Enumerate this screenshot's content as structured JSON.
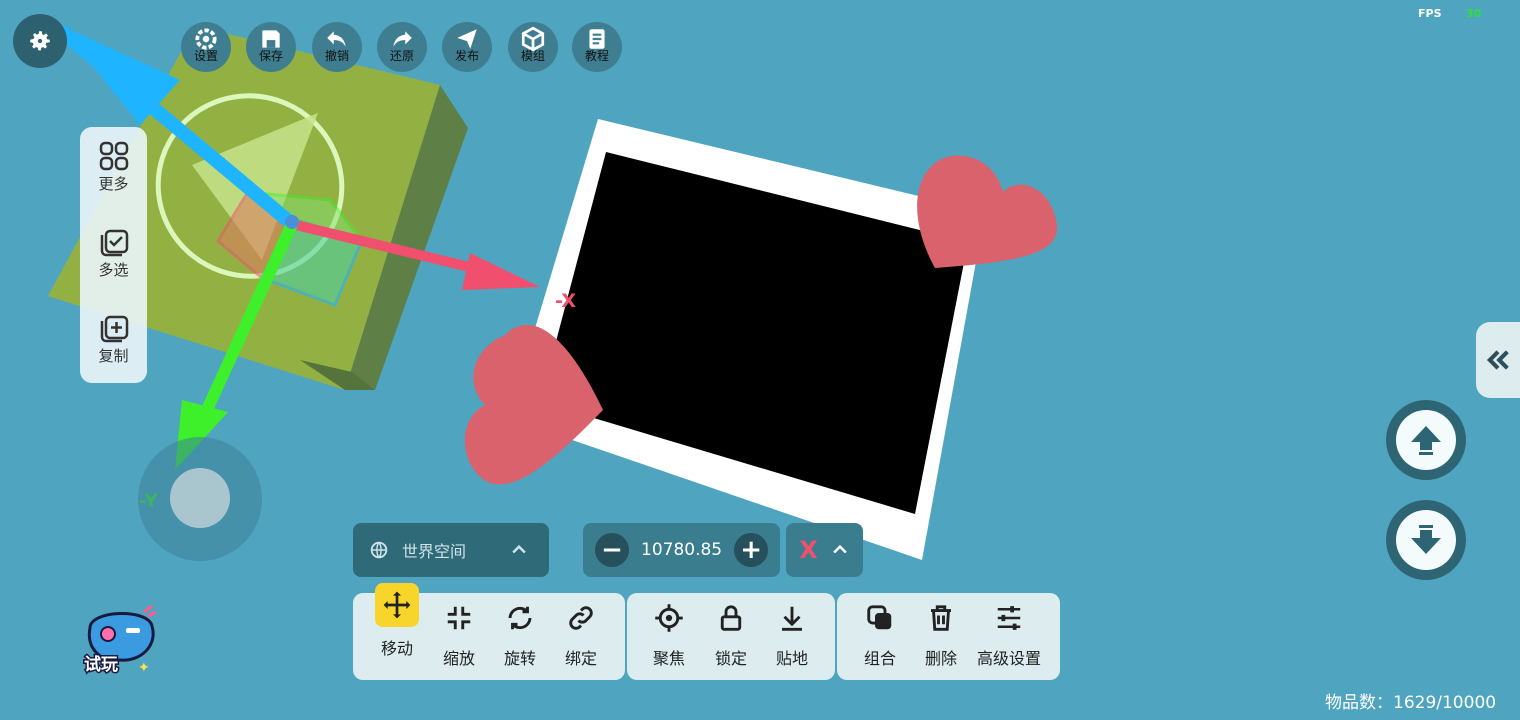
{
  "hud": {
    "fps_label": "FPS",
    "fps_value": "30",
    "item_count": "物品数：1629/10000"
  },
  "top_toolbar": [
    {
      "label": "设置",
      "icon": "settings-icon"
    },
    {
      "label": "保存",
      "icon": "save-icon"
    },
    {
      "label": "撤销",
      "icon": "undo-icon"
    },
    {
      "label": "还原",
      "icon": "redo-icon"
    },
    {
      "label": "发布",
      "icon": "publish-icon"
    },
    {
      "label": "模组",
      "icon": "module-icon"
    },
    {
      "label": "教程",
      "icon": "tutorial-icon"
    }
  ],
  "left_panel": [
    {
      "label": "更多",
      "icon": "more-grid-icon"
    },
    {
      "label": "多选",
      "icon": "multi-select-icon"
    },
    {
      "label": "复制",
      "icon": "copy-icon"
    }
  ],
  "gizmo": {
    "x_label": "-X",
    "y_label": "-Y",
    "x_color": "#f0506e",
    "y_color": "#3df02a",
    "z_color": "#1fb4ff"
  },
  "space_selector": {
    "label": "世界空间"
  },
  "value_box": {
    "value": "10780.85",
    "minus": "−",
    "plus": "+"
  },
  "axis_selector": {
    "value": "X",
    "color": "#f0506e"
  },
  "bottom_toolbar": {
    "transform": [
      {
        "label": "移动",
        "icon": "move-icon",
        "active": true
      },
      {
        "label": "缩放",
        "icon": "scale-icon"
      },
      {
        "label": "旋转",
        "icon": "rotate-icon"
      },
      {
        "label": "绑定",
        "icon": "bind-link-icon"
      }
    ],
    "view": [
      {
        "label": "聚焦",
        "icon": "focus-target-icon"
      },
      {
        "label": "锁定",
        "icon": "lock-icon"
      },
      {
        "label": "贴地",
        "icon": "snap-ground-icon"
      }
    ],
    "edit": [
      {
        "label": "组合",
        "icon": "group-icon"
      },
      {
        "label": "删除",
        "icon": "trash-icon"
      },
      {
        "label": "高级设置",
        "icon": "advanced-sliders-icon"
      }
    ]
  },
  "trial_button": {
    "label": "试玩"
  },
  "colors": {
    "background": "#4fa5c0",
    "accent_yellow": "#f7d52a",
    "heart": "#d9626d",
    "platform": "#93b142"
  }
}
